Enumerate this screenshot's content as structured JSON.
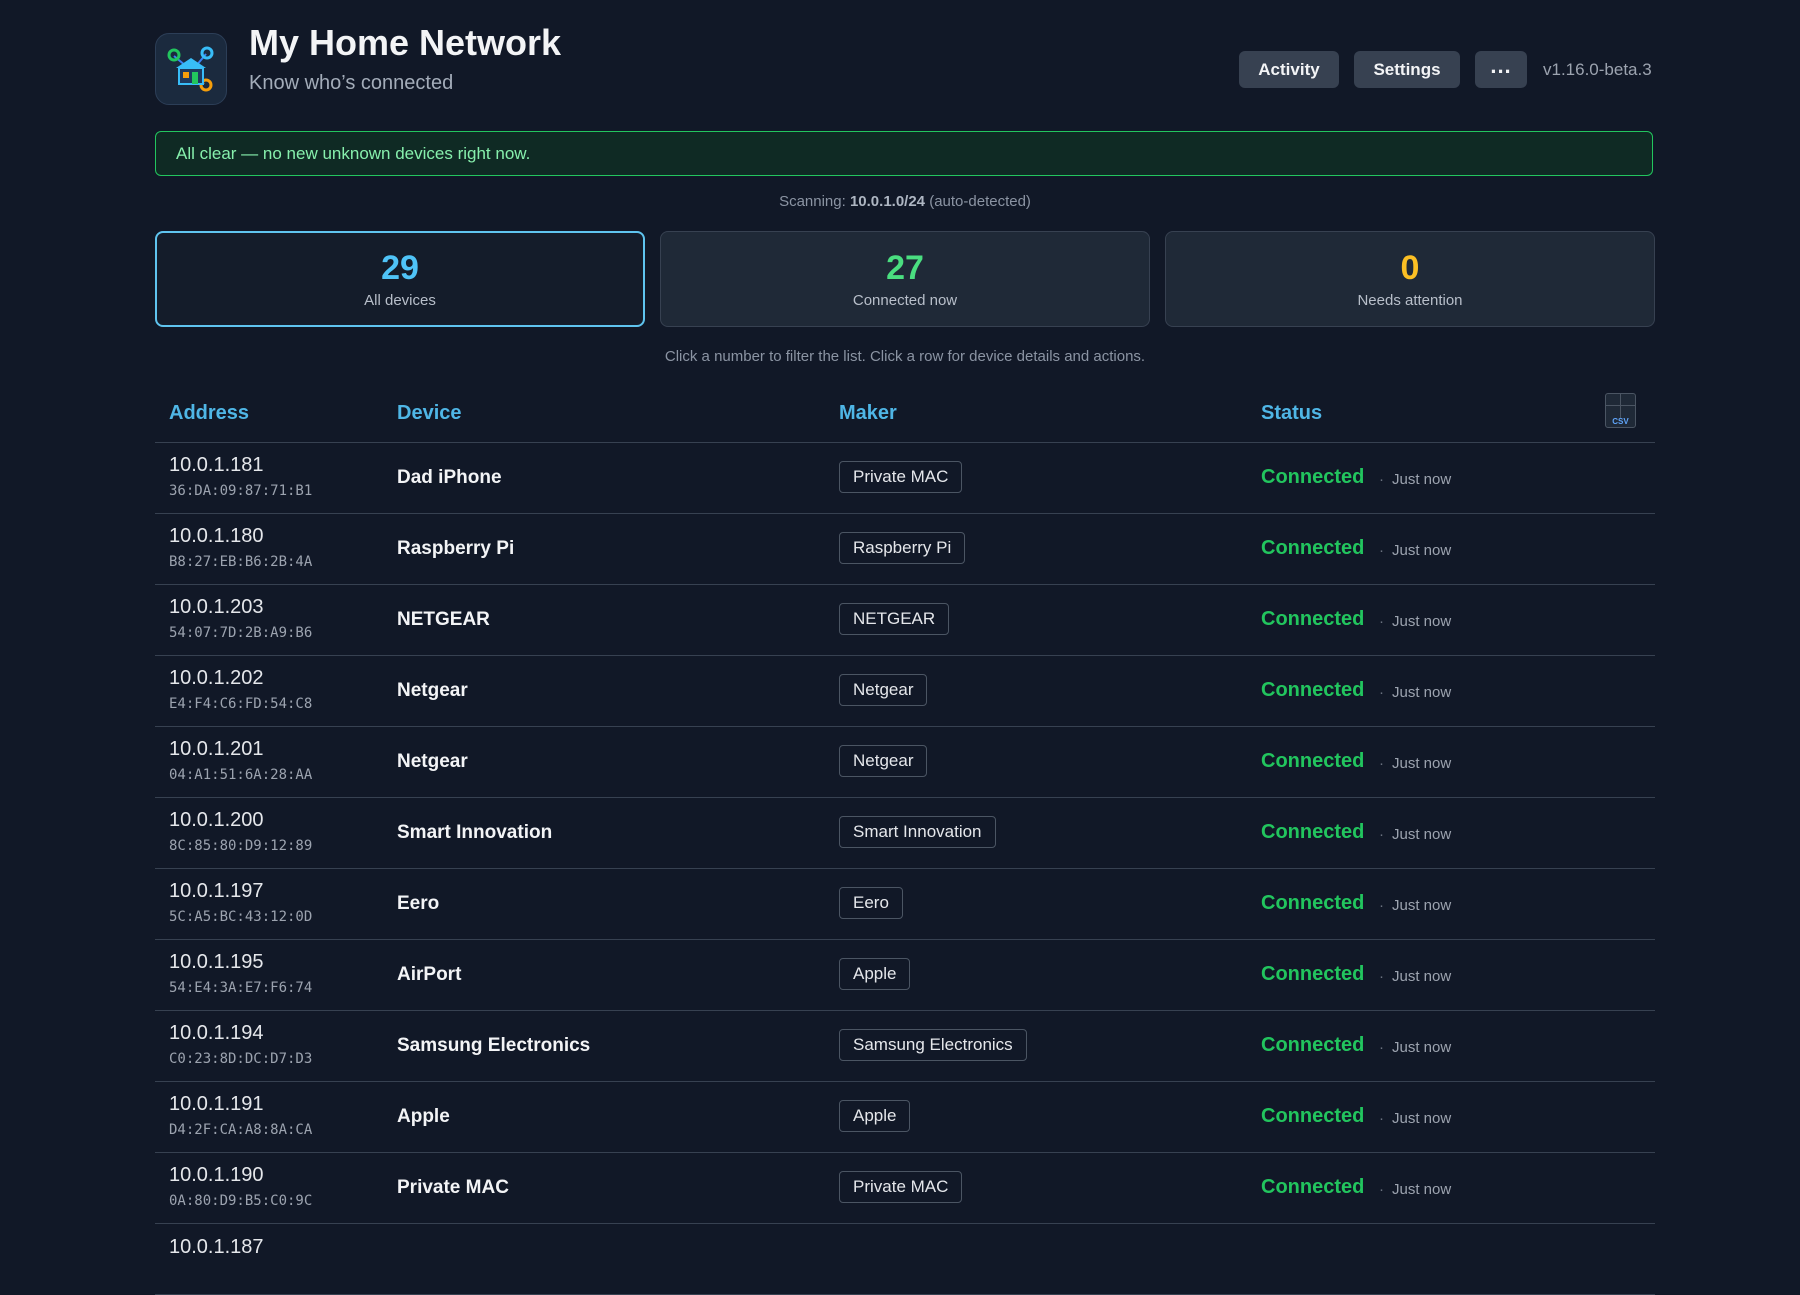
{
  "app": {
    "title": "My Home Network",
    "subtitle": "Know who’s connected",
    "version": "v1.16.0-beta.3"
  },
  "header_buttons": {
    "activity": "Activity",
    "settings": "Settings",
    "more": "..."
  },
  "banner": {
    "text": "All clear — no new unknown devices right now.",
    "color": "#22c55e"
  },
  "scanning": {
    "prefix": "Scanning:",
    "subnet": "10.0.1.0/24",
    "suffix": "(auto-detected)"
  },
  "stats": [
    {
      "value": "29",
      "label": "All devices",
      "color": "#4fc3f7"
    },
    {
      "value": "27",
      "label": "Connected now",
      "color": "#4ade80"
    },
    {
      "value": "0",
      "label": "Needs attention",
      "color": "#fbbf24"
    }
  ],
  "hint": "Click a number to filter the list. Click a row for device details and actions.",
  "table": {
    "headers": {
      "address": "Address",
      "device": "Device",
      "maker": "Maker",
      "status": "Status"
    },
    "csv_label": "CSV",
    "rows": [
      {
        "ip": "10.0.1.181",
        "mac": "36:DA:09:87:71:B1",
        "device": "Dad iPhone",
        "maker": "Private MAC",
        "status": "Connected",
        "seen": "Just now"
      },
      {
        "ip": "10.0.1.180",
        "mac": "B8:27:EB:B6:2B:4A",
        "device": "Raspberry Pi",
        "maker": "Raspberry Pi",
        "status": "Connected",
        "seen": "Just now"
      },
      {
        "ip": "10.0.1.203",
        "mac": "54:07:7D:2B:A9:B6",
        "device": "NETGEAR",
        "maker": "NETGEAR",
        "status": "Connected",
        "seen": "Just now"
      },
      {
        "ip": "10.0.1.202",
        "mac": "E4:F4:C6:FD:54:C8",
        "device": "Netgear",
        "maker": "Netgear",
        "status": "Connected",
        "seen": "Just now"
      },
      {
        "ip": "10.0.1.201",
        "mac": "04:A1:51:6A:28:AA",
        "device": "Netgear",
        "maker": "Netgear",
        "status": "Connected",
        "seen": "Just now"
      },
      {
        "ip": "10.0.1.200",
        "mac": "8C:85:80:D9:12:89",
        "device": "Smart Innovation",
        "maker": "Smart Innovation",
        "status": "Connected",
        "seen": "Just now"
      },
      {
        "ip": "10.0.1.197",
        "mac": "5C:A5:BC:43:12:0D",
        "device": "Eero",
        "maker": "Eero",
        "status": "Connected",
        "seen": "Just now"
      },
      {
        "ip": "10.0.1.195",
        "mac": "54:E4:3A:E7:F6:74",
        "device": "AirPort",
        "maker": "Apple",
        "status": "Connected",
        "seen": "Just now"
      },
      {
        "ip": "10.0.1.194",
        "mac": "C0:23:8D:DC:D7:D3",
        "device": "Samsung Electronics",
        "maker": "Samsung Electronics",
        "status": "Connected",
        "seen": "Just now"
      },
      {
        "ip": "10.0.1.191",
        "mac": "D4:2F:CA:A8:8A:CA",
        "device": "Apple",
        "maker": "Apple",
        "status": "Connected",
        "seen": "Just now"
      },
      {
        "ip": "10.0.1.190",
        "mac": "0A:80:D9:B5:C0:9C",
        "device": "Private MAC",
        "maker": "Private MAC",
        "status": "Connected",
        "seen": "Just now"
      }
    ],
    "partial_row_ip": "10.0.1.187"
  }
}
